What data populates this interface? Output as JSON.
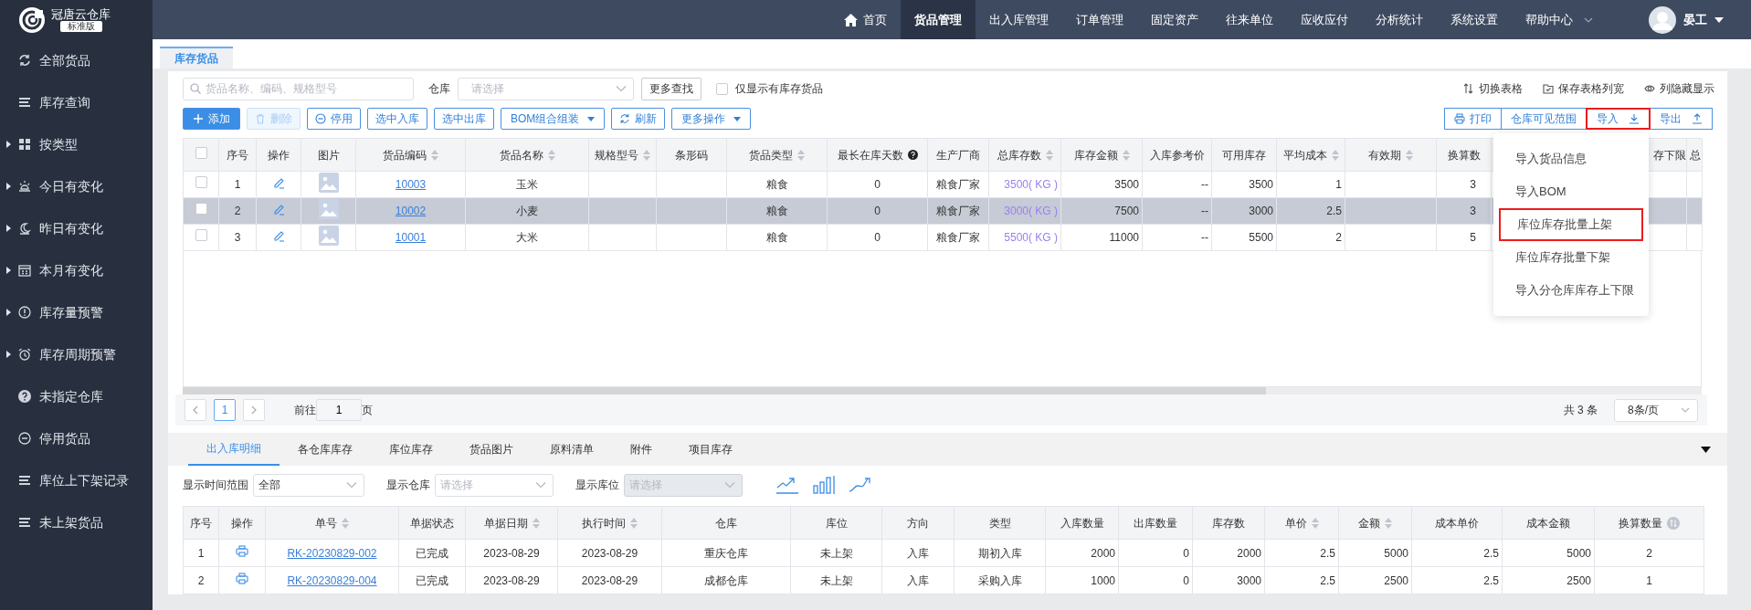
{
  "app": {
    "name": "冠唐云仓库",
    "edition": "标准版"
  },
  "top_nav": {
    "items": [
      {
        "label": "首页",
        "kind": "home",
        "selected": false
      },
      {
        "label": "货品管理",
        "kind": "plain",
        "selected": true
      },
      {
        "label": "出入库管理",
        "kind": "plain",
        "selected": false
      },
      {
        "label": "订单管理",
        "kind": "plain",
        "selected": false
      },
      {
        "label": "固定资产",
        "kind": "plain",
        "selected": false
      },
      {
        "label": "往来单位",
        "kind": "plain",
        "selected": false
      },
      {
        "label": "应收应付",
        "kind": "plain",
        "selected": false
      },
      {
        "label": "分析统计",
        "kind": "plain",
        "selected": false
      },
      {
        "label": "系统设置",
        "kind": "plain",
        "selected": false
      },
      {
        "label": "帮助中心",
        "kind": "dropdown",
        "selected": false
      }
    ],
    "user": "晏工"
  },
  "sidebar": {
    "items": [
      {
        "label": "全部货品",
        "expandable": false
      },
      {
        "label": "库存查询",
        "expandable": false
      },
      {
        "label": "按类型",
        "expandable": true
      },
      {
        "label": "今日有变化",
        "expandable": true
      },
      {
        "label": "昨日有变化",
        "expandable": true
      },
      {
        "label": "本月有变化",
        "expandable": true
      },
      {
        "label": "库存量预警",
        "expandable": true
      },
      {
        "label": "库存周期预警",
        "expandable": true
      },
      {
        "label": "未指定仓库",
        "expandable": false
      },
      {
        "label": "停用货品",
        "expandable": false
      },
      {
        "label": "库位上下架记录",
        "expandable": false
      },
      {
        "label": "未上架货品",
        "expandable": false
      }
    ]
  },
  "page_tabs": [
    {
      "label": "库存货品",
      "selected": true
    }
  ],
  "search": {
    "placeholder": "货品名称、编码、规格型号",
    "warehouse_label": "仓库",
    "warehouse_placeholder": "请选择",
    "more_button": "更多查找",
    "stock_only": {
      "label": "仅显示有库存货品",
      "checked": false
    }
  },
  "view_links": [
    "切换表格",
    "保存表格列宽",
    "列隐藏显示"
  ],
  "actions": [
    {
      "label": "添加",
      "kind": "primary",
      "disabled": false
    },
    {
      "label": "删除",
      "kind": "plain",
      "disabled": true
    },
    {
      "label": "停用",
      "kind": "plain",
      "disabled": false
    },
    {
      "label": "选中入库",
      "kind": "plain",
      "disabled": false
    },
    {
      "label": "选中出库",
      "kind": "plain",
      "disabled": false
    },
    {
      "label": "BOM组合组装",
      "kind": "menu",
      "disabled": false
    },
    {
      "label": "刷新",
      "kind": "plain",
      "disabled": false
    },
    {
      "label": "更多操作",
      "kind": "menu",
      "disabled": false
    }
  ],
  "right_buttons": [
    {
      "label": "打印",
      "kind": "plain",
      "highlighted": false
    },
    {
      "label": "仓库可见范围",
      "kind": "plain",
      "highlighted": false
    },
    {
      "label": "导入",
      "kind": "import",
      "highlighted": true
    },
    {
      "label": "导出",
      "kind": "export",
      "highlighted": false
    }
  ],
  "import_menu": {
    "items": [
      {
        "label": "导入货品信息",
        "highlighted": false
      },
      {
        "label": "导入BOM",
        "highlighted": false
      },
      {
        "label": "库位库存批量上架",
        "highlighted": true
      },
      {
        "label": "库位库存批量下架",
        "highlighted": false
      },
      {
        "label": "导入分仓库库存上下限",
        "highlighted": false
      }
    ]
  },
  "table": {
    "select_all_checked": false,
    "columns": [
      {
        "label": "序号",
        "sortable": false,
        "help": false
      },
      {
        "label": "操作",
        "sortable": false,
        "help": false
      },
      {
        "label": "图片",
        "sortable": false,
        "help": false
      },
      {
        "label": "货品编码",
        "sortable": true,
        "help": false
      },
      {
        "label": "货品名称",
        "sortable": true,
        "help": false
      },
      {
        "label": "规格型号",
        "sortable": true,
        "help": false
      },
      {
        "label": "条形码",
        "sortable": false,
        "help": false
      },
      {
        "label": "货品类型",
        "sortable": true,
        "help": false
      },
      {
        "label": "最长在库天数",
        "sortable": false,
        "help": true
      },
      {
        "label": "生产厂商",
        "sortable": false,
        "help": false
      },
      {
        "label": "总库存数",
        "sortable": true,
        "help": false
      },
      {
        "label": "库存金额",
        "sortable": true,
        "help": false
      },
      {
        "label": "入库参考价",
        "sortable": false,
        "help": false
      },
      {
        "label": "可用库存",
        "sortable": false,
        "help": false
      },
      {
        "label": "平均成本",
        "sortable": true,
        "help": false
      },
      {
        "label": "有效期",
        "sortable": true,
        "help": false
      },
      {
        "label": "换算数",
        "sortable": false,
        "help": false
      },
      {
        "label": "存下限",
        "sortable": false,
        "help": false
      },
      {
        "label": "总",
        "sortable": false,
        "help": false
      }
    ],
    "rows": [
      {
        "checked": false,
        "selected": false,
        "no": "1",
        "code": "10003",
        "name": "玉米",
        "type": "粮食",
        "max_days": "0",
        "maker": "粮食厂家",
        "total_stock": "3500( KG )",
        "stock_amount": "3500",
        "ref_price": "--",
        "available": "3500",
        "avg_cost": "1",
        "conversion": "3"
      },
      {
        "checked": false,
        "selected": true,
        "no": "2",
        "code": "10002",
        "name": "小麦",
        "type": "粮食",
        "max_days": "0",
        "maker": "粮食厂家",
        "total_stock": "3000( KG )",
        "stock_amount": "7500",
        "ref_price": "--",
        "available": "3000",
        "avg_cost": "2.5",
        "conversion": "3"
      },
      {
        "checked": false,
        "selected": false,
        "no": "3",
        "code": "10001",
        "name": "大米",
        "type": "粮食",
        "max_days": "0",
        "maker": "粮食厂家",
        "total_stock": "5500( KG )",
        "stock_amount": "11000",
        "ref_price": "--",
        "available": "5500",
        "avg_cost": "2",
        "conversion": "5"
      }
    ]
  },
  "pagination": {
    "pages": [
      {
        "label": "1",
        "selected": true
      }
    ],
    "goto_label": "前往",
    "goto_value": "1",
    "goto_suffix": "页",
    "total": "共 3 条",
    "page_size": "8条/页"
  },
  "detail_tabs": [
    {
      "label": "出入库明细",
      "selected": true
    },
    {
      "label": "各仓库库存",
      "selected": false
    },
    {
      "label": "库位库存",
      "selected": false
    },
    {
      "label": "货品图片",
      "selected": false
    },
    {
      "label": "原料清单",
      "selected": false
    },
    {
      "label": "附件",
      "selected": false
    },
    {
      "label": "项目库存",
      "selected": false
    }
  ],
  "filters": [
    {
      "label": "显示时间范围",
      "value": "全部",
      "disabled": false
    },
    {
      "label": "显示仓库",
      "placeholder": "请选择",
      "disabled": false
    },
    {
      "label": "显示库位",
      "placeholder": "请选择",
      "disabled": true
    }
  ],
  "detail_table": {
    "columns": [
      {
        "label": "序号",
        "sortable": false,
        "swap": false
      },
      {
        "label": "操作",
        "sortable": false,
        "swap": false
      },
      {
        "label": "单号",
        "sortable": true,
        "swap": false
      },
      {
        "label": "单据状态",
        "sortable": false,
        "swap": false
      },
      {
        "label": "单据日期",
        "sortable": true,
        "swap": false
      },
      {
        "label": "执行时间",
        "sortable": true,
        "swap": false
      },
      {
        "label": "仓库",
        "sortable": false,
        "swap": false
      },
      {
        "label": "库位",
        "sortable": false,
        "swap": false
      },
      {
        "label": "方向",
        "sortable": false,
        "swap": false
      },
      {
        "label": "类型",
        "sortable": false,
        "swap": false
      },
      {
        "label": "入库数量",
        "sortable": false,
        "swap": false
      },
      {
        "label": "出库数量",
        "sortable": false,
        "swap": false
      },
      {
        "label": "库存数",
        "sortable": false,
        "swap": false
      },
      {
        "label": "单价",
        "sortable": true,
        "swap": false
      },
      {
        "label": "金额",
        "sortable": true,
        "swap": false
      },
      {
        "label": "成本单价",
        "sortable": false,
        "swap": false
      },
      {
        "label": "成本金额",
        "sortable": false,
        "swap": false
      },
      {
        "label": "换算数量",
        "sortable": false,
        "swap": true
      }
    ],
    "rows": [
      {
        "no": "1",
        "number": "RK-20230829-002",
        "status": "已完成",
        "doc_date": "2023-08-29",
        "exec_time": "2023-08-29",
        "warehouse": "重庆仓库",
        "location": "未上架",
        "direction": "入库",
        "type": "期初入库",
        "in_qty": "2000",
        "out_qty": "0",
        "stock": "2000",
        "price": "2.5",
        "amount": "5000",
        "cost_price": "2.5",
        "cost_amount": "5000",
        "conversion": "2"
      },
      {
        "no": "2",
        "number": "RK-20230829-004",
        "status": "已完成",
        "doc_date": "2023-08-29",
        "exec_time": "2023-08-29",
        "warehouse": "成都仓库",
        "location": "未上架",
        "direction": "入库",
        "type": "采购入库",
        "in_qty": "1000",
        "out_qty": "0",
        "stock": "3000",
        "price": "2.5",
        "amount": "2500",
        "cost_price": "2.5",
        "cost_amount": "2500",
        "conversion": "1"
      }
    ]
  }
}
